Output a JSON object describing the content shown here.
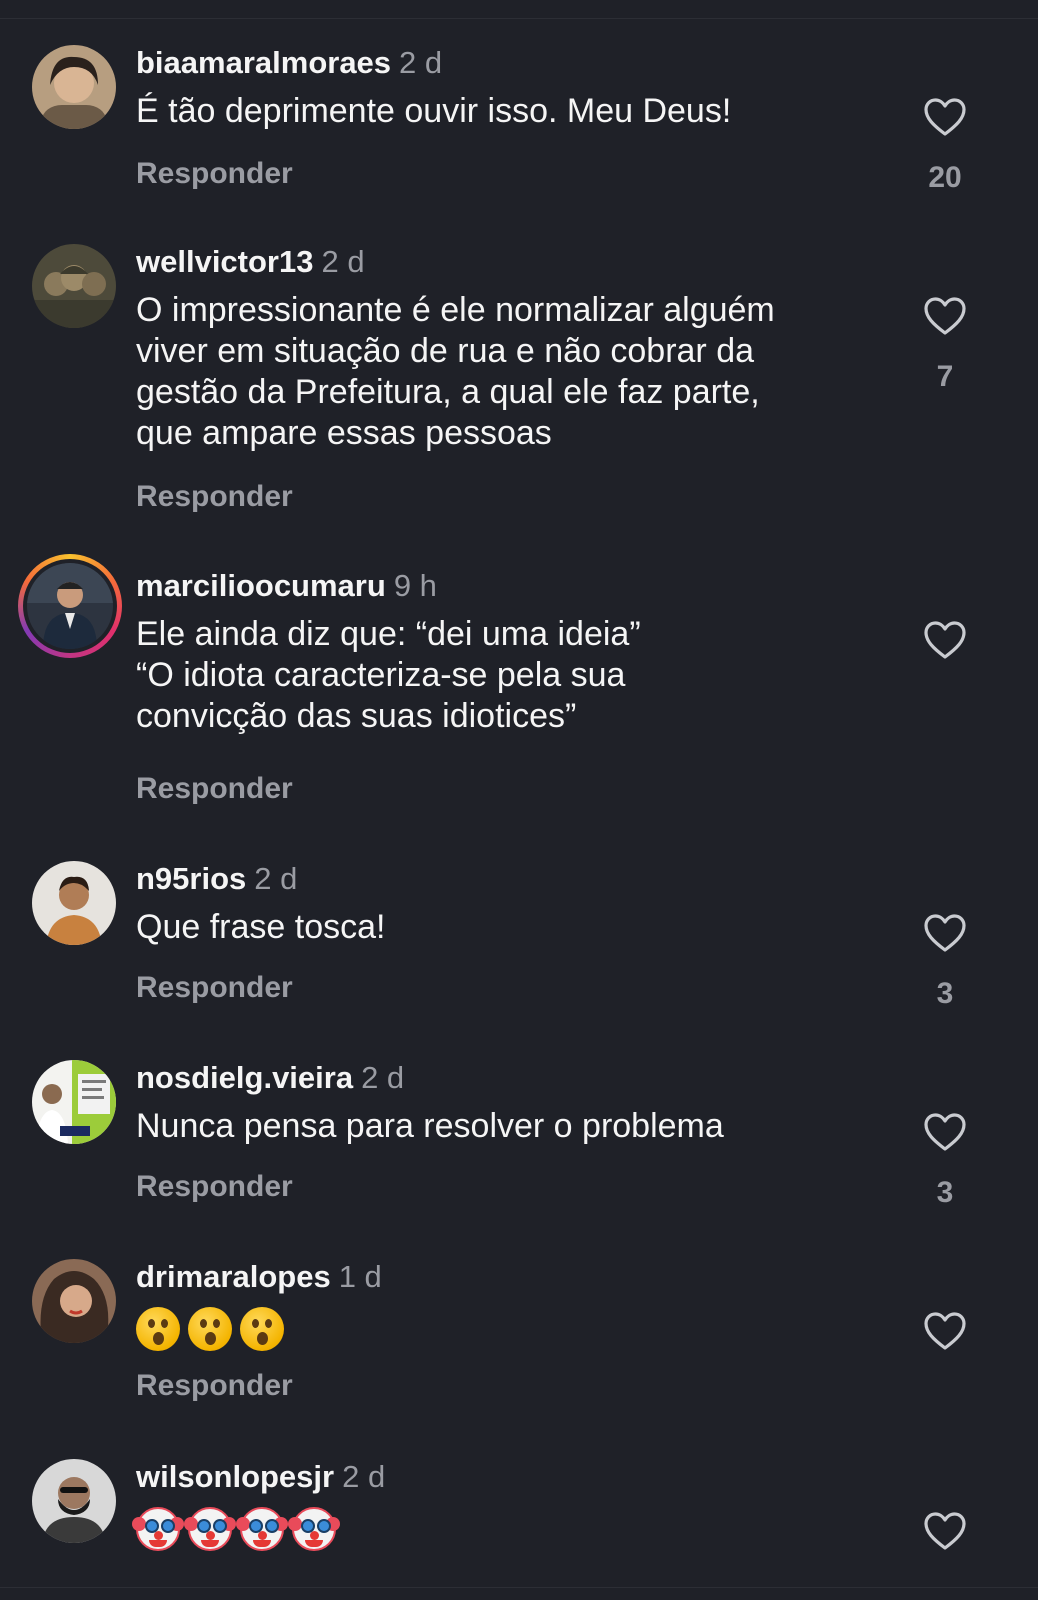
{
  "comments": [
    {
      "username": "biaamaralmoraes",
      "time": "2 d",
      "text": "É tão deprimente ouvir isso. Meu Deus!",
      "reply": "Responder",
      "likes": "20",
      "avatar_color": "#8a7a62"
    },
    {
      "username": "wellvictor13",
      "time": "2 d",
      "text": "O impressionante é ele normalizar alguém\nviver em situação de rua e não cobrar da\ngestão da Prefeitura, a qual ele faz parte,\nque ampare essas pessoas",
      "reply": "Responder",
      "likes": "7",
      "avatar_color": "#5a5a4a"
    },
    {
      "username": "marcilioocumaru",
      "time": "9 h",
      "text": "Ele ainda diz que: “dei uma ideia”\n“O idiota caracteriza-se pela sua\nconvicção das suas idiotices”",
      "reply": "Responder",
      "likes": "",
      "avatar_color": "#34404e"
    },
    {
      "username": "n95rios",
      "time": "2 d",
      "text": "Que frase tosca!",
      "reply": "Responder",
      "likes": "3",
      "avatar_color": "#c49a6c"
    },
    {
      "username": "nosdielg.vieira",
      "time": "2 d",
      "text": "Nunca pensa para resolver o problema",
      "reply": "Responder",
      "likes": "3",
      "avatar_color": "#9ccc3a"
    },
    {
      "username": "drimaralopes",
      "time": "1 d",
      "emojis": [
        "face-with-open-mouth",
        "face-with-open-mouth",
        "face-with-open-mouth"
      ],
      "reply": "Responder",
      "likes": "",
      "avatar_color": "#5e4436"
    },
    {
      "username": "wilsonlopesjr",
      "time": "2 d",
      "emojis": [
        "clown-face",
        "clown-face",
        "clown-face",
        "clown-face"
      ],
      "reply": "",
      "likes": "",
      "avatar_color": "#6d6f73"
    }
  ],
  "colors": {
    "background": "#1f2128",
    "primary_text": "#f5f5f5",
    "secondary_text": "#9a9ca3",
    "story_ring": [
      "#f9c22e",
      "#e1306c",
      "#833ab4"
    ]
  },
  "icons": {
    "like": "heart-outline-icon"
  }
}
